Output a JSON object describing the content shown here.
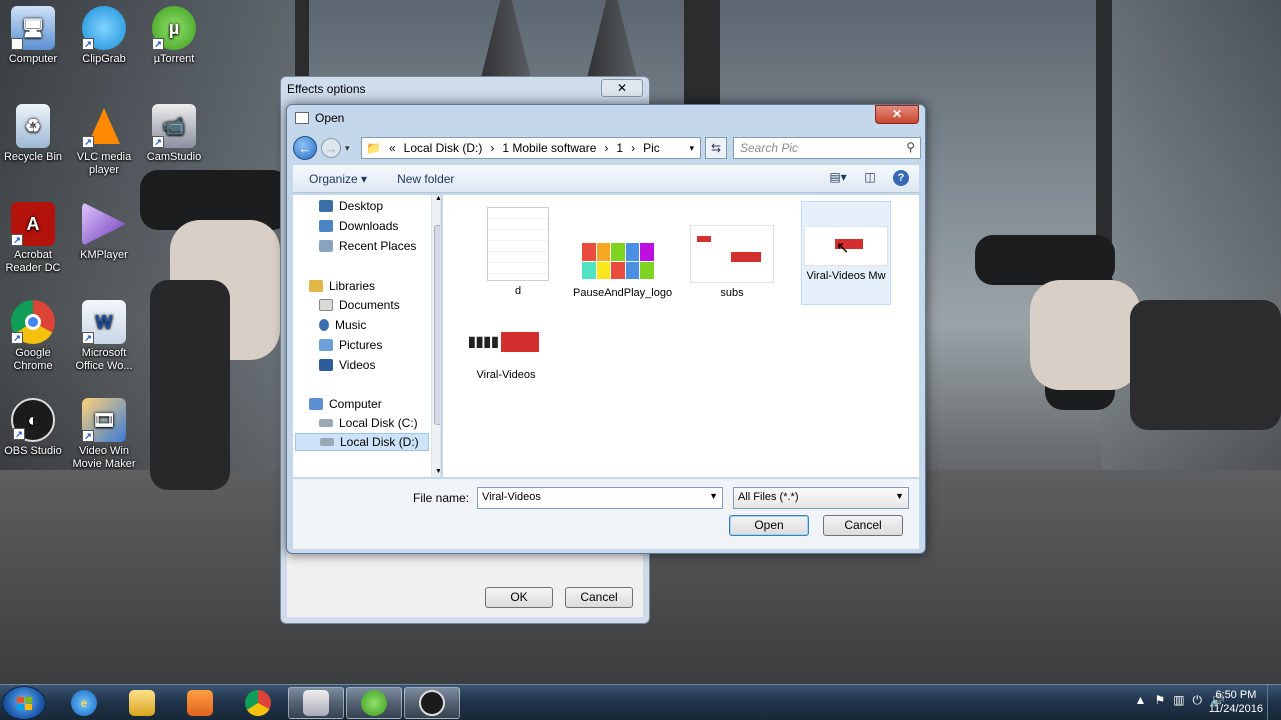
{
  "desktop": {
    "icons": [
      {
        "label": "Computer",
        "icon": "computer-icon"
      },
      {
        "label": "ClipGrab",
        "icon": "clipgrab-icon"
      },
      {
        "label": "µTorrent",
        "icon": "utorrent-icon"
      },
      {
        "label": "Recycle Bin",
        "icon": "recycle-bin-icon"
      },
      {
        "label": "VLC media player",
        "icon": "vlc-icon"
      },
      {
        "label": "CamStudio",
        "icon": "camstudio-icon"
      },
      {
        "label": "Acrobat Reader DC",
        "icon": "acrobat-icon"
      },
      {
        "label": "KMPlayer",
        "icon": "kmplayer-icon"
      },
      {
        "label": "Google Chrome",
        "icon": "chrome-icon"
      },
      {
        "label": "Microsoft Office Wo...",
        "icon": "word-icon"
      },
      {
        "label": "OBS Studio",
        "icon": "obs-icon"
      },
      {
        "label": "Video Win Movie Maker",
        "icon": "movie-maker-icon"
      }
    ]
  },
  "effects_dialog": {
    "title": "Effects options",
    "close": "✕",
    "ok_label": "OK",
    "cancel_label": "Cancel"
  },
  "open_dialog": {
    "title": "Open",
    "close": "✕",
    "address": {
      "prefix": "«",
      "segments": [
        "Local Disk (D:)",
        "1 Mobile software",
        "1",
        "Pic"
      ]
    },
    "search_placeholder": "Search Pic",
    "toolbar": {
      "organize": "Organize ▾",
      "new_folder": "New folder"
    },
    "nav": {
      "favorites": [
        "Desktop",
        "Downloads",
        "Recent Places"
      ],
      "libraries": "Libraries",
      "library_items": [
        "Documents",
        "Music",
        "Pictures",
        "Videos"
      ],
      "computer": "Computer",
      "drives": [
        "Local Disk (C:)",
        "Local Disk (D:)"
      ]
    },
    "files": [
      {
        "name": "d"
      },
      {
        "name": "PauseAndPlay_logo"
      },
      {
        "name": "subs"
      },
      {
        "name": "Viral-Videos Mw"
      },
      {
        "name": "Viral-Videos"
      }
    ],
    "file_name_label": "File name:",
    "file_name_value": "Viral-Videos",
    "file_type_value": "All Files (*.*)",
    "open_label": "Open",
    "cancel_label": "Cancel"
  },
  "taskbar": {
    "clock_time": "6:50 PM",
    "clock_date": "11/24/2016"
  },
  "colors": {
    "accent": "#3468b4",
    "close_red": "#c5452e",
    "selection": "#cde3f7"
  }
}
